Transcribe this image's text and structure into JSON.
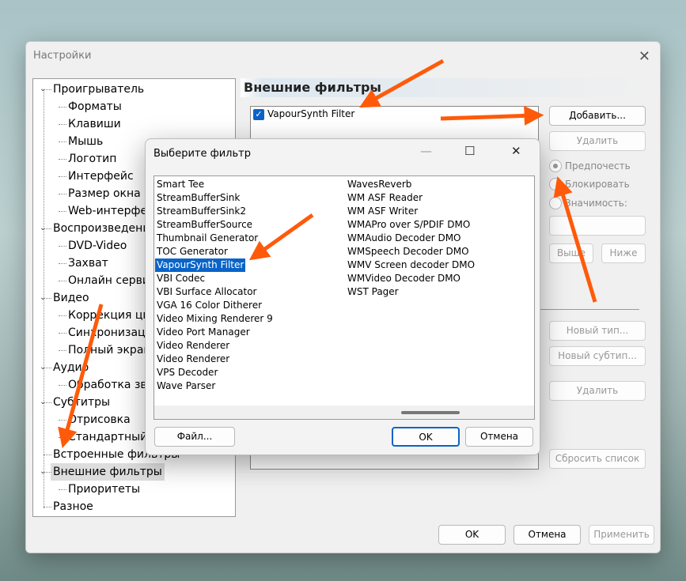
{
  "main": {
    "title": "Настройки",
    "close": "✕",
    "header": "Внешние фильтры",
    "tree": [
      {
        "label": "Проигрыватель",
        "level": 0,
        "expander": true
      },
      {
        "label": "Форматы",
        "level": 1
      },
      {
        "label": "Клавиши",
        "level": 1
      },
      {
        "label": "Мышь",
        "level": 1
      },
      {
        "label": "Логотип",
        "level": 1
      },
      {
        "label": "Интерфейс",
        "level": 1
      },
      {
        "label": "Размер окна",
        "level": 1
      },
      {
        "label": "Web-интерфейс",
        "level": 1
      },
      {
        "label": "Воспроизведение",
        "level": 0,
        "expander": true
      },
      {
        "label": "DVD-Video",
        "level": 1
      },
      {
        "label": "Захват",
        "level": 1
      },
      {
        "label": "Онлайн сервисы",
        "level": 1
      },
      {
        "label": "Видео",
        "level": 0,
        "expander": true
      },
      {
        "label": "Коррекция цвета",
        "level": 1
      },
      {
        "label": "Синхронизация",
        "level": 1
      },
      {
        "label": "Полный экран",
        "level": 1
      },
      {
        "label": "Аудио",
        "level": 0,
        "expander": true
      },
      {
        "label": "Обработка звука",
        "level": 1
      },
      {
        "label": "Субтитры",
        "level": 0,
        "expander": true
      },
      {
        "label": "Отрисовка",
        "level": 1
      },
      {
        "label": "Стандартный стиль",
        "level": 1
      },
      {
        "label": "Встроенные фильтры",
        "level": 0
      },
      {
        "label": "Внешние фильтры",
        "level": 0,
        "expander": true,
        "selected": true
      },
      {
        "label": "Приоритеты",
        "level": 1
      },
      {
        "label": "Разное",
        "level": 0
      }
    ],
    "filter_item": "VapourSynth Filter",
    "buttons": {
      "add": "Добавить...",
      "remove": "Удалить",
      "up": "Выше",
      "down": "Ниже",
      "new_type": "Новый тип...",
      "new_subtype": "Новый субтип...",
      "remove2": "Удалить",
      "reset": "Сбросить список",
      "ok": "OK",
      "cancel": "Отмена",
      "apply": "Применить"
    },
    "radios": {
      "prefer": "Предпочесть",
      "block": "Блокировать",
      "merit": "Значимость:"
    }
  },
  "dialog": {
    "title": "Выберите фильтр",
    "minimize": "—",
    "maximize": "☐",
    "close": "✕",
    "col1": [
      "Smart Tee",
      "StreamBufferSink",
      "StreamBufferSink2",
      "StreamBufferSource",
      "Thumbnail Generator",
      "TOC Generator",
      "VapourSynth Filter",
      "VBI Codec",
      "VBI Surface Allocator",
      "VGA 16 Color Ditherer",
      "Video Mixing Renderer 9",
      "Video Port Manager",
      "Video Renderer",
      "Video Renderer",
      "VPS Decoder",
      "Wave Parser"
    ],
    "col2": [
      "WavesReverb",
      "WM ASF Reader",
      "WM ASF Writer",
      "WMAPro over S/PDIF DMO",
      "WMAudio Decoder DMO",
      "WMSpeech Decoder DMO",
      "WMV Screen decoder DMO",
      "WMVideo Decoder DMO",
      "WST Pager"
    ],
    "selected": "VapourSynth Filter",
    "file": "Файл...",
    "ok": "OK",
    "cancel": "Отмена"
  },
  "colors": {
    "accent": "#0a64c8",
    "arrow": "#ff5a0a"
  }
}
